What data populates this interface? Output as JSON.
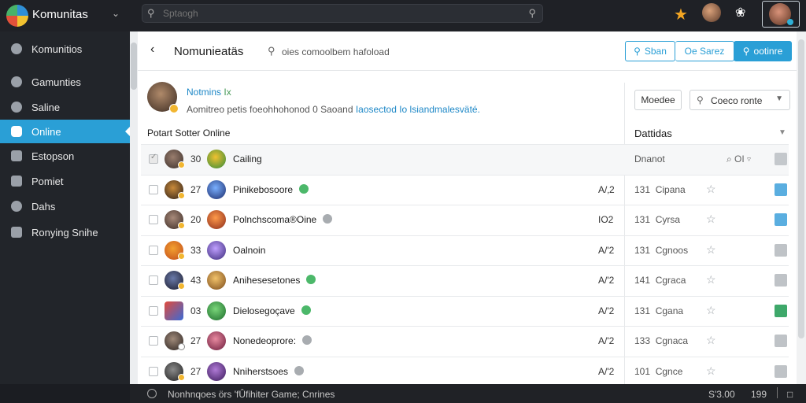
{
  "app": {
    "name": "Komunitas",
    "search_placeholder": "Sptaogh",
    "colors": {
      "accent": "#2a9fd6",
      "sidebar": "#22252a",
      "topbar": "#1f2126"
    }
  },
  "sidebar": {
    "items": [
      {
        "label": "Komunitios",
        "icon": "community-icon"
      },
      {
        "label": "Gamunties",
        "icon": "gamepad-icon"
      },
      {
        "label": "Saline",
        "icon": "globe-icon"
      },
      {
        "label": "Online",
        "icon": "online-icon",
        "active": true
      },
      {
        "label": "Estopson",
        "icon": "grid-icon"
      },
      {
        "label": "Pomiet",
        "icon": "chat-icon"
      },
      {
        "label": "Dahs",
        "icon": "users-icon"
      },
      {
        "label": "Ronying Snihe",
        "icon": "list-icon"
      }
    ]
  },
  "header": {
    "title": "Nomunieatäs",
    "search_text": "oies comoolbem hafoload",
    "buttons": {
      "search": "Sban",
      "games": "Oe Sarez",
      "primary": "ootinre"
    }
  },
  "profile": {
    "name": "Notmins",
    "name_suffix": "Ix",
    "desc_prefix": "Aomitreo petis foeohhohonod 0 Saoand",
    "desc_link": "Iaosectod Io lsiandmalesväté."
  },
  "controls": {
    "mode_button": "Moedee",
    "select_value": "Coeco ronte"
  },
  "section": {
    "title": "Potart Sotter Online",
    "right_title": "Dattidas"
  },
  "table": {
    "header": {
      "rank": "30",
      "game": "Cailing",
      "col": "Dnanot",
      "icons": "⌕ OI ▿"
    },
    "rows": [
      {
        "rank": "27",
        "name": "Pinikebosoore",
        "status": "green",
        "score": "A/‚2",
        "count": "131",
        "label": "Cipana",
        "action": "blue"
      },
      {
        "rank": "20",
        "name": "Polnchscoma®Oine",
        "status": "gray",
        "score": "IO2",
        "count": "131",
        "label": "Cyrsa",
        "action": "blue"
      },
      {
        "rank": "33",
        "name": "Oalnoin",
        "status": "none",
        "score": "A/'2",
        "count": "131",
        "label": "Cgnoos",
        "action": "gray"
      },
      {
        "rank": "43",
        "name": "Anihesesetones",
        "status": "green",
        "score": "A/'2",
        "count": "141",
        "label": "Cgraca",
        "action": "gray"
      },
      {
        "rank": "03",
        "name": "Dielosegoçave",
        "status": "green",
        "score": "A/'2",
        "count": "131",
        "label": "Cgana",
        "action": "green"
      },
      {
        "rank": "27",
        "name": "Nonedeoprore:",
        "status": "gray",
        "score": "A/'2",
        "count": "133",
        "label": "Cgnaca",
        "action": "gray"
      },
      {
        "rank": "27",
        "name": "Nniherstsoes",
        "status": "gray",
        "score": "A/'2",
        "count": "101",
        "label": "Cgnce",
        "action": "gray"
      }
    ]
  },
  "footer": {
    "text": "Nonhnqoes örs 'fÛfihiter Game; Cnrines",
    "a": "S'3.00",
    "b": "199"
  }
}
